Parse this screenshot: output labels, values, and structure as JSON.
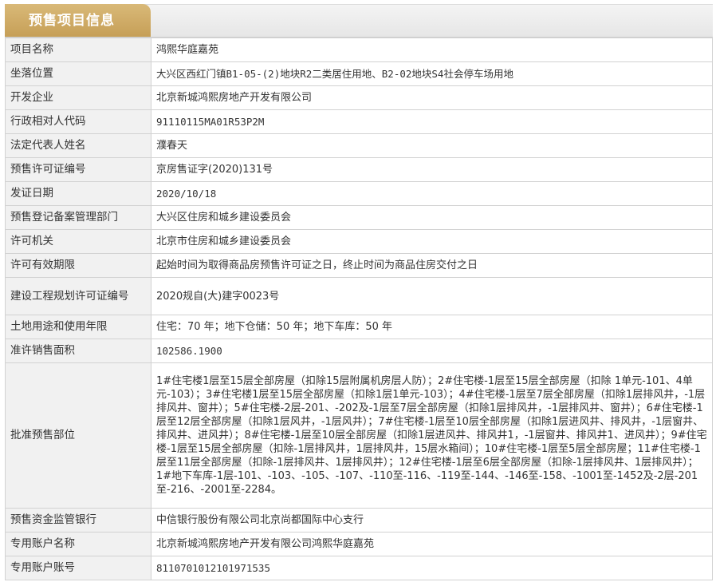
{
  "header": {
    "title": "预售项目信息"
  },
  "rows": [
    {
      "label": "项目名称",
      "value": "鸿熙华庭嘉苑"
    },
    {
      "label": "坐落位置",
      "value": "大兴区西红门镇B1-05-(2)地块R2二类居住用地、B2-02地块S4社会停车场用地"
    },
    {
      "label": "开发企业",
      "value": "北京新城鸿熙房地产开发有限公司"
    },
    {
      "label": "行政相对人代码",
      "value": "91110115MA01R53P2M"
    },
    {
      "label": "法定代表人姓名",
      "value": "濮春天"
    },
    {
      "label": "预售许可证编号",
      "value": "京房售证字(2020)131号"
    },
    {
      "label": "发证日期",
      "value": "2020/10/18"
    },
    {
      "label": "预售登记备案管理部门",
      "value": "大兴区住房和城乡建设委员会"
    },
    {
      "label": "许可机关",
      "value": "北京市住房和城乡建设委员会"
    },
    {
      "label": "许可有效期限",
      "value": "起始时间为取得商品房预售许可证之日，终止时间为商品住房交付之日"
    },
    {
      "label": "建设工程规划许可证编号",
      "value": "2020规自(大)建字0023号"
    },
    {
      "label": "土地用途和使用年限",
      "value": "住宅：70 年；地下仓储：50 年；地下车库：50 年"
    },
    {
      "label": "准许销售面积",
      "value": "102586.1900"
    },
    {
      "label": "批准预售部位",
      "value": "1#住宅楼1层至15层全部房屋（扣除15层附属机房层人防）；2#住宅楼-1层至15层全部房屋（扣除 1单元-101、4单元-103）；3#住宅楼1层至15层全部房屋（扣除1层1单元-103）；4#住宅楼-1层至7层全部房屋（扣除1层排风井，-1层排风井、窗井）；5#住宅楼-2层-201、-202及-1层至7层全部房屋（扣除1层排风井，-1层排风井、窗井）；6#住宅楼-1层至12层全部房屋（扣除1层风井，-1层风井）；7#住宅楼-1层至10层全部房屋（扣除1层进风井、排风井，-1层窗井、排风井、进风井）；8#住宅楼-1层至10层全部房屋（扣除1层进风井、排风井1，-1层窗井、排风井1、进风井）；9#住宅楼-1层至15层全部房屋（扣除-1层排风井，1层排风井，15层水箱间）；10#住宅楼-1层至5层全部房屋；11#住宅楼-1层至11层全部房屋（扣除-1层排风井、1层排风井）；12#住宅楼-1层至6层全部房屋（扣除-1层排风井、1层排风井）；1#地下车库-1层-101、-103、-105、-107、-110至-116、-119至-144、-146至-158、-1001至-1452及-2层-201至-216、-2001至-2284。"
    },
    {
      "label": "预售资金监管银行",
      "value": "中信银行股份有限公司北京尚都国际中心支行"
    },
    {
      "label": "专用账户名称",
      "value": "北京新城鸿熙房地产开发有限公司鸿熙华庭嘉苑"
    },
    {
      "label": "专用账户账号",
      "value": "8110701012101971535"
    }
  ]
}
